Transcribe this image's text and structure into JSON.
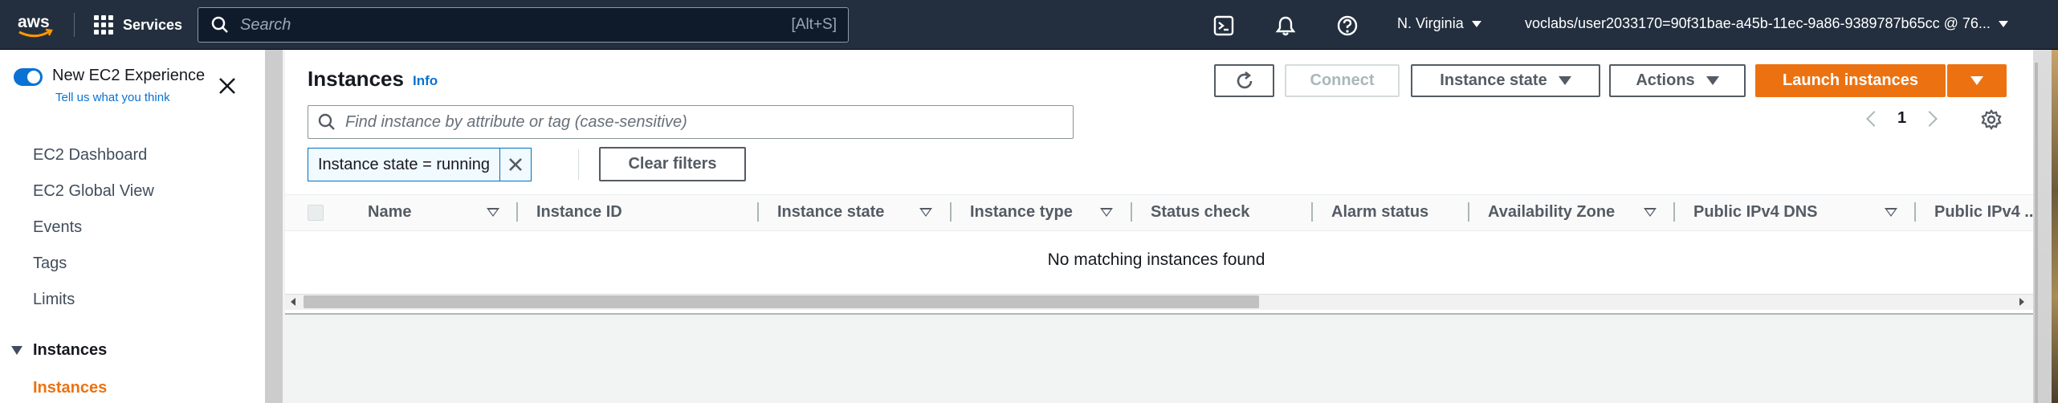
{
  "topnav": {
    "logo_text": "aws",
    "services_label": "Services",
    "search_placeholder": "Search",
    "search_shortcut": "[Alt+S]",
    "region": "N. Virginia",
    "account": "voclabs/user2033170=90f31bae-a45b-11ec-9a86-9389787b65cc @ 76..."
  },
  "sidebar": {
    "new_experience": "New EC2 Experience",
    "tell_us": "Tell us what you think",
    "items": [
      {
        "label": "EC2 Dashboard"
      },
      {
        "label": "EC2 Global View"
      },
      {
        "label": "Events"
      },
      {
        "label": "Tags"
      },
      {
        "label": "Limits"
      }
    ],
    "section": "Instances",
    "active_item": "Instances"
  },
  "main": {
    "title": "Instances",
    "info": "Info",
    "buttons": {
      "connect": "Connect",
      "instance_state": "Instance state",
      "actions": "Actions",
      "launch": "Launch instances"
    },
    "filter_placeholder": "Find instance by attribute or tag (case-sensitive)",
    "page_number": "1",
    "chip": "Instance state = running",
    "clear_filters": "Clear filters",
    "columns": [
      {
        "label": "Name"
      },
      {
        "label": "Instance ID"
      },
      {
        "label": "Instance state"
      },
      {
        "label": "Instance type"
      },
      {
        "label": "Status check"
      },
      {
        "label": "Alarm status"
      },
      {
        "label": "Availability Zone"
      },
      {
        "label": "Public IPv4 DNS"
      },
      {
        "label": "Public IPv4 ..."
      }
    ],
    "empty_message": "No matching instances found"
  },
  "colors": {
    "nav_bg": "#232f3e",
    "accent_orange": "#ec7211",
    "link_blue": "#0972d3"
  }
}
